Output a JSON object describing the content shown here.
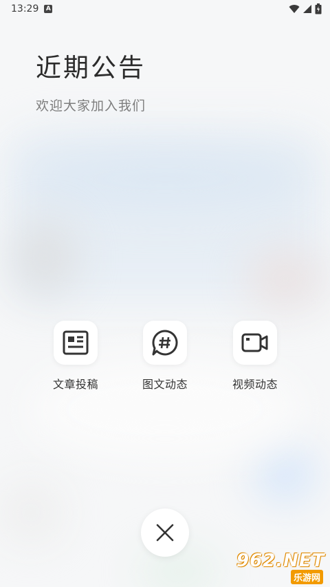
{
  "status_bar": {
    "time": "13:29",
    "notification_icon": "a-notification-icon",
    "right_icons": [
      "wifi-icon",
      "signal-icon",
      "battery-icon"
    ]
  },
  "header": {
    "title": "近期公告",
    "subtitle": "欢迎大家加入我们"
  },
  "actions": [
    {
      "label": "文章投稿",
      "icon": "article-icon"
    },
    {
      "label": "图文动态",
      "icon": "hashtag-chat-icon"
    },
    {
      "label": "视频动态",
      "icon": "video-camera-icon"
    }
  ],
  "close_button": {
    "icon": "close-icon"
  },
  "watermark": {
    "line1": "962.NET",
    "line2": "乐游网"
  },
  "colors": {
    "text_primary": "#2b2b2b",
    "text_secondary": "#7d7d7d",
    "icon_stroke": "#333333",
    "card_background": "#ffffff"
  }
}
